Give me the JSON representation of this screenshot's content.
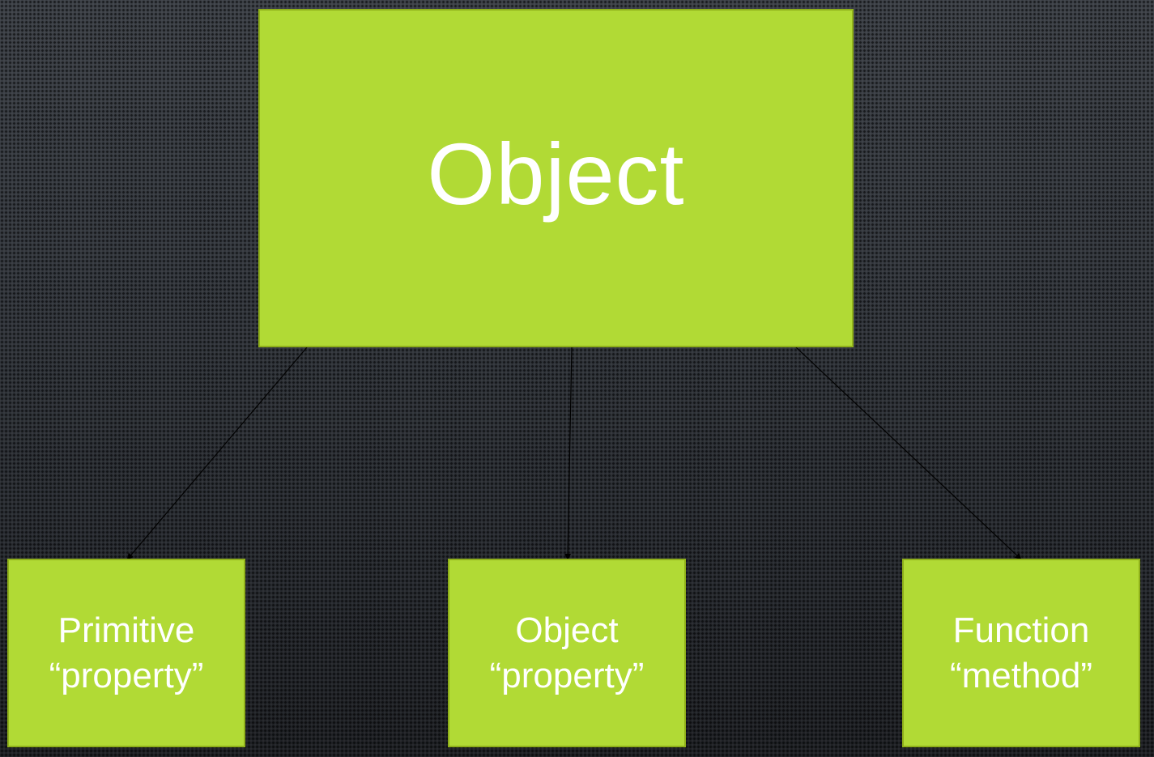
{
  "colors": {
    "box_fill": "#b1da35",
    "box_text": "#ffffff",
    "connector": "#000000"
  },
  "diagram": {
    "root": {
      "label": "Object"
    },
    "children": [
      {
        "line1": "Primitive",
        "line2": "“property”"
      },
      {
        "line1": "Object",
        "line2": "“property”"
      },
      {
        "line1": "Function",
        "line2": "“method”"
      }
    ]
  }
}
